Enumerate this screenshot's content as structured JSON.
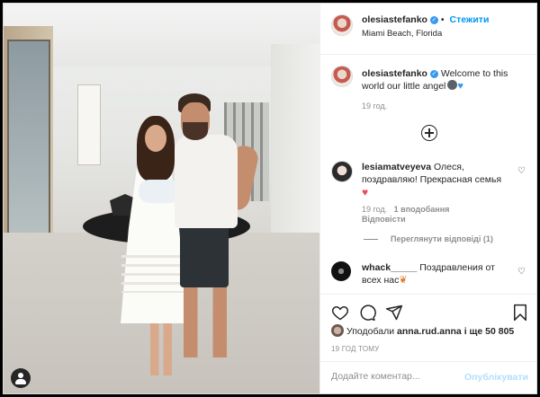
{
  "header": {
    "username": "olesiastefanko",
    "follow_label": "Стежити",
    "location": "Miami Beach, Florida"
  },
  "caption": {
    "username": "olesiastefanko",
    "text": "Welcome to this world our little angel",
    "time": "19 год."
  },
  "comments": [
    {
      "username": "lesiamatveyeva",
      "text": "Олеся, поздравляю! Прекрасная семья",
      "time": "19 год.",
      "likes": "1 вподобання",
      "reply_label": "Відповісти",
      "view_replies": "Переглянути відповіді (1)"
    },
    {
      "username": "whack_____",
      "text": "Поздравления от всех нас"
    }
  ],
  "likes_text": {
    "prefix": "Уподобали",
    "user": "anna.rud.anna",
    "suffix": "і ще 50 805"
  },
  "date": "19 ГОД ТОМУ",
  "add_comment": {
    "placeholder": "Додайте коментар...",
    "publish_label": "Опублікувати"
  },
  "icons": {
    "like": "heart-icon",
    "comment": "comment-icon",
    "share": "share-icon",
    "save": "bookmark-icon",
    "more": "plus-circle-icon",
    "tags": "user-tag-icon"
  },
  "colors": {
    "accent": "#0095f6",
    "verified": "#3897f0",
    "muted": "#8e8e8e"
  }
}
